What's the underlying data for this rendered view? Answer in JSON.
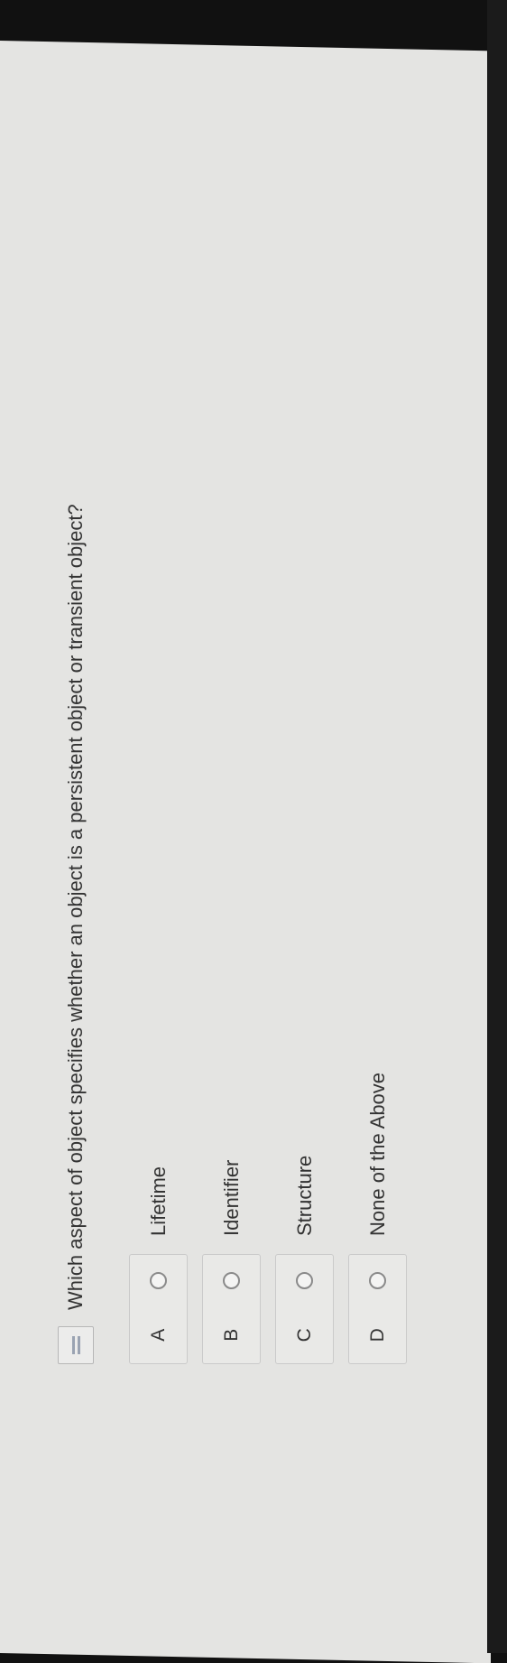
{
  "question": {
    "text": "Which aspect of object specifies whether an object is a persistent object or transient object?",
    "icon": "question-list-icon"
  },
  "choices": [
    {
      "letter": "A",
      "label": "Lifetime"
    },
    {
      "letter": "B",
      "label": "Identifier"
    },
    {
      "letter": "C",
      "label": "Structure"
    },
    {
      "letter": "D",
      "label": "None of the Above"
    }
  ],
  "colors": {
    "screen_background": "#e4e4e2",
    "text": "#333333",
    "radio_border": "#8a8a8a"
  }
}
